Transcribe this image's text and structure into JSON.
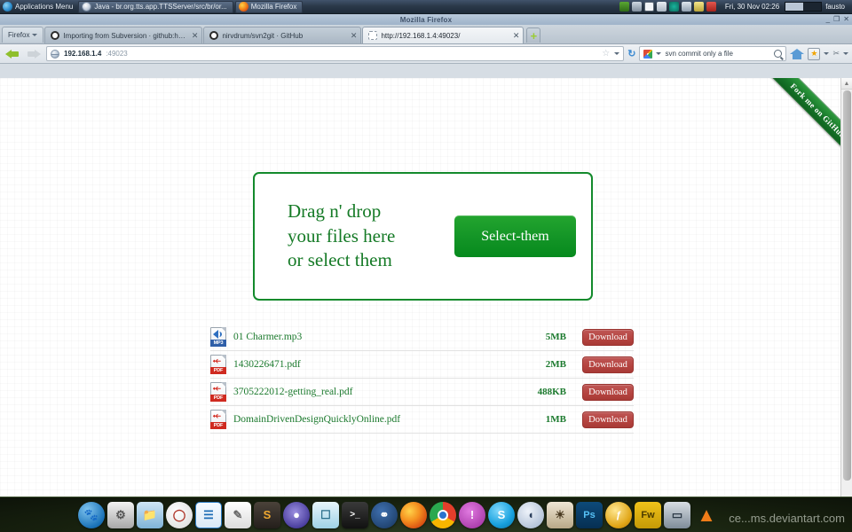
{
  "desktop": {
    "applications_menu": "Applications Menu",
    "tasks": [
      {
        "label": "Java - br.org.tts.app.TTSServer/src/br/or...",
        "icon": "java-icon"
      },
      {
        "label": "Mozilla Firefox",
        "icon": "firefox-icon"
      }
    ],
    "tray_icons": [
      "updates-icon",
      "battery-icon",
      "mail-icon",
      "volume-muted-icon",
      "network-monitor-icon",
      "wifi-icon",
      "notes-icon",
      "bug-icon"
    ],
    "clock": "Fri, 30 Nov 02:26",
    "user": "fausto"
  },
  "browser": {
    "window_title": "Mozilla Firefox",
    "window_buttons": {
      "minimize": "_",
      "maximize": "❐",
      "close": "✕"
    },
    "firefox_menu_label": "Firefox",
    "tabs": [
      {
        "label": "Importing from Subversion · github:help",
        "favicon": "github-icon",
        "active": false
      },
      {
        "label": "nirvdrum/svn2git · GitHub",
        "favicon": "github-icon",
        "active": false
      },
      {
        "label": "http://192.168.1.4:49023/",
        "favicon": "blank-favicon",
        "active": true
      }
    ],
    "new_tab_label": "+",
    "url": {
      "host": "192.168.1.4",
      "rest": ":49023"
    },
    "search": {
      "value": "svn commit only a file",
      "engine": "google-icon"
    },
    "toolbar_icons": [
      "back-icon",
      "forward-icon",
      "bookmark-star-icon",
      "reload-icon",
      "home-icon",
      "bookmarks-icon",
      "tools-icon"
    ]
  },
  "page": {
    "ribbon": "Fork me on GitHub",
    "dropzone": {
      "text_line1": "Drag n' drop",
      "text_line2": "your files here",
      "text_line3": "or select them",
      "button_label": "Select-them"
    },
    "files": [
      {
        "name": "01 Charmer.mp3",
        "size": "5MB",
        "type": "MP3",
        "action": "Download"
      },
      {
        "name": "1430226471.pdf",
        "size": "2MB",
        "type": "PDF",
        "action": "Download"
      },
      {
        "name": "3705222012-getting_real.pdf",
        "size": "488KB",
        "type": "PDF",
        "action": "Download"
      },
      {
        "name": "DomainDrivenDesignQuicklyOnline.pdf",
        "size": "1MB",
        "type": "PDF",
        "action": "Download"
      }
    ],
    "colors": {
      "accent_green": "#138a2c",
      "download_red": "#b4433f",
      "link_green": "#1c7a2e"
    }
  },
  "dock": {
    "items": [
      {
        "name": "mouse-settings-icon",
        "glyph": "❄"
      },
      {
        "name": "trash-icon",
        "glyph": "☗"
      },
      {
        "name": "file-manager-icon",
        "glyph": "❐"
      },
      {
        "name": "clock-icon",
        "glyph": "◷"
      },
      {
        "name": "libreoffice-writer-icon",
        "glyph": "≡"
      },
      {
        "name": "text-editor-icon",
        "glyph": "✎"
      },
      {
        "name": "sublime-text-icon",
        "glyph": "S"
      },
      {
        "name": "eclipse-icon",
        "glyph": "●"
      },
      {
        "name": "virtualbox-icon",
        "glyph": "□"
      },
      {
        "name": "terminal-icon",
        "glyph": ">_"
      },
      {
        "name": "network-icon",
        "glyph": "⧖"
      },
      {
        "name": "firefox-icon",
        "glyph": "◔"
      },
      {
        "name": "chrome-icon",
        "glyph": "●"
      },
      {
        "name": "pidgin-icon",
        "glyph": "!"
      },
      {
        "name": "skype-icon",
        "glyph": "S"
      },
      {
        "name": "maya-icon",
        "glyph": "◗"
      },
      {
        "name": "gimp-icon",
        "glyph": "◕"
      },
      {
        "name": "photoshop-icon",
        "glyph": "Ps"
      },
      {
        "name": "flash-icon",
        "glyph": "Fl"
      },
      {
        "name": "fireworks-icon",
        "glyph": "Fw"
      },
      {
        "name": "window-manager-icon",
        "glyph": "▭"
      },
      {
        "name": "vlc-icon",
        "glyph": "▲"
      }
    ],
    "watermark": "ce...ms.deviantart.com"
  }
}
